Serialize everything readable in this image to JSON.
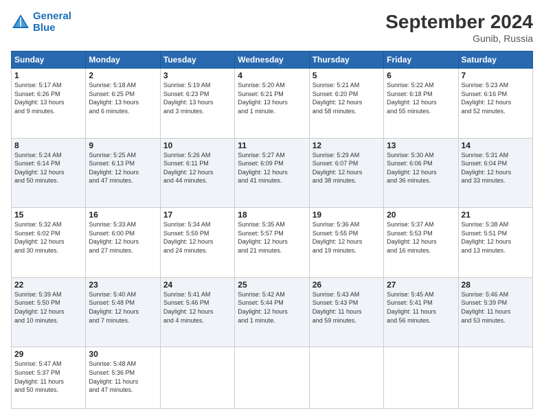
{
  "header": {
    "logo_line1": "General",
    "logo_line2": "Blue",
    "month": "September 2024",
    "location": "Gunib, Russia"
  },
  "weekdays": [
    "Sunday",
    "Monday",
    "Tuesday",
    "Wednesday",
    "Thursday",
    "Friday",
    "Saturday"
  ],
  "weeks": [
    [
      {
        "day": "1",
        "info": "Sunrise: 5:17 AM\nSunset: 6:26 PM\nDaylight: 13 hours\nand 9 minutes."
      },
      {
        "day": "2",
        "info": "Sunrise: 5:18 AM\nSunset: 6:25 PM\nDaylight: 13 hours\nand 6 minutes."
      },
      {
        "day": "3",
        "info": "Sunrise: 5:19 AM\nSunset: 6:23 PM\nDaylight: 13 hours\nand 3 minutes."
      },
      {
        "day": "4",
        "info": "Sunrise: 5:20 AM\nSunset: 6:21 PM\nDaylight: 13 hours\nand 1 minute."
      },
      {
        "day": "5",
        "info": "Sunrise: 5:21 AM\nSunset: 6:20 PM\nDaylight: 12 hours\nand 58 minutes."
      },
      {
        "day": "6",
        "info": "Sunrise: 5:22 AM\nSunset: 6:18 PM\nDaylight: 12 hours\nand 55 minutes."
      },
      {
        "day": "7",
        "info": "Sunrise: 5:23 AM\nSunset: 6:16 PM\nDaylight: 12 hours\nand 52 minutes."
      }
    ],
    [
      {
        "day": "8",
        "info": "Sunrise: 5:24 AM\nSunset: 6:14 PM\nDaylight: 12 hours\nand 50 minutes."
      },
      {
        "day": "9",
        "info": "Sunrise: 5:25 AM\nSunset: 6:13 PM\nDaylight: 12 hours\nand 47 minutes."
      },
      {
        "day": "10",
        "info": "Sunrise: 5:26 AM\nSunset: 6:11 PM\nDaylight: 12 hours\nand 44 minutes."
      },
      {
        "day": "11",
        "info": "Sunrise: 5:27 AM\nSunset: 6:09 PM\nDaylight: 12 hours\nand 41 minutes."
      },
      {
        "day": "12",
        "info": "Sunrise: 5:29 AM\nSunset: 6:07 PM\nDaylight: 12 hours\nand 38 minutes."
      },
      {
        "day": "13",
        "info": "Sunrise: 5:30 AM\nSunset: 6:06 PM\nDaylight: 12 hours\nand 36 minutes."
      },
      {
        "day": "14",
        "info": "Sunrise: 5:31 AM\nSunset: 6:04 PM\nDaylight: 12 hours\nand 33 minutes."
      }
    ],
    [
      {
        "day": "15",
        "info": "Sunrise: 5:32 AM\nSunset: 6:02 PM\nDaylight: 12 hours\nand 30 minutes."
      },
      {
        "day": "16",
        "info": "Sunrise: 5:33 AM\nSunset: 6:00 PM\nDaylight: 12 hours\nand 27 minutes."
      },
      {
        "day": "17",
        "info": "Sunrise: 5:34 AM\nSunset: 5:59 PM\nDaylight: 12 hours\nand 24 minutes."
      },
      {
        "day": "18",
        "info": "Sunrise: 5:35 AM\nSunset: 5:57 PM\nDaylight: 12 hours\nand 21 minutes."
      },
      {
        "day": "19",
        "info": "Sunrise: 5:36 AM\nSunset: 5:55 PM\nDaylight: 12 hours\nand 19 minutes."
      },
      {
        "day": "20",
        "info": "Sunrise: 5:37 AM\nSunset: 5:53 PM\nDaylight: 12 hours\nand 16 minutes."
      },
      {
        "day": "21",
        "info": "Sunrise: 5:38 AM\nSunset: 5:51 PM\nDaylight: 12 hours\nand 13 minutes."
      }
    ],
    [
      {
        "day": "22",
        "info": "Sunrise: 5:39 AM\nSunset: 5:50 PM\nDaylight: 12 hours\nand 10 minutes."
      },
      {
        "day": "23",
        "info": "Sunrise: 5:40 AM\nSunset: 5:48 PM\nDaylight: 12 hours\nand 7 minutes."
      },
      {
        "day": "24",
        "info": "Sunrise: 5:41 AM\nSunset: 5:46 PM\nDaylight: 12 hours\nand 4 minutes."
      },
      {
        "day": "25",
        "info": "Sunrise: 5:42 AM\nSunset: 5:44 PM\nDaylight: 12 hours\nand 1 minute."
      },
      {
        "day": "26",
        "info": "Sunrise: 5:43 AM\nSunset: 5:43 PM\nDaylight: 11 hours\nand 59 minutes."
      },
      {
        "day": "27",
        "info": "Sunrise: 5:45 AM\nSunset: 5:41 PM\nDaylight: 11 hours\nand 56 minutes."
      },
      {
        "day": "28",
        "info": "Sunrise: 5:46 AM\nSunset: 5:39 PM\nDaylight: 11 hours\nand 53 minutes."
      }
    ],
    [
      {
        "day": "29",
        "info": "Sunrise: 5:47 AM\nSunset: 5:37 PM\nDaylight: 11 hours\nand 50 minutes."
      },
      {
        "day": "30",
        "info": "Sunrise: 5:48 AM\nSunset: 5:36 PM\nDaylight: 11 hours\nand 47 minutes."
      },
      {
        "day": "",
        "info": ""
      },
      {
        "day": "",
        "info": ""
      },
      {
        "day": "",
        "info": ""
      },
      {
        "day": "",
        "info": ""
      },
      {
        "day": "",
        "info": ""
      }
    ]
  ]
}
